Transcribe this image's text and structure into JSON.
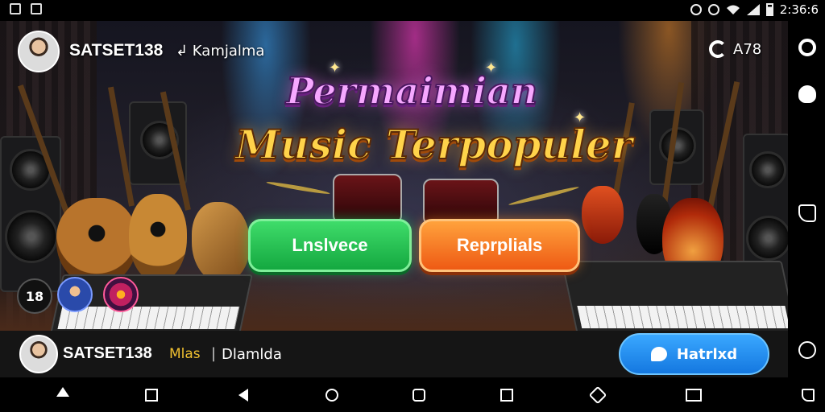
{
  "status_bar": {
    "time": "2:36:6",
    "icons": [
      "notification-square-icon",
      "gallery-icon",
      "alarm-icon",
      "timer-icon",
      "wifi-icon",
      "signal-icon",
      "battery-icon"
    ]
  },
  "header": {
    "username": "SATSET138",
    "subtitle": "↲ Kamjalma",
    "counter": "A78",
    "counter_icon": "gear-icon"
  },
  "hero": {
    "title_line1": "Permaimian",
    "title_line2": "Music Terpopuler"
  },
  "buttons": {
    "primary_label": "Lnslvece",
    "secondary_label": "Reprplials"
  },
  "badges": {
    "age_label": "18"
  },
  "bottom_bar": {
    "username": "SATSET138",
    "tag": "Mlas",
    "separator": "|",
    "subtitle": "Dlamlda",
    "action_label": "Hatrlxd"
  },
  "colors": {
    "primary_green": "#1fbf4f",
    "secondary_orange": "#f37a22",
    "action_blue": "#1e8ff0",
    "title_pink": "#f6a8ff",
    "title_gold": "#ffd34a"
  },
  "right_rail": [
    "search-icon",
    "heart-search-icon",
    "chat-bubble-icon",
    "zoom-icon"
  ],
  "nav_bar": [
    "home-icon",
    "home-outline-icon",
    "back-icon",
    "chat-icon",
    "info-icon",
    "recents-icon",
    "tag-icon",
    "window-icon",
    "message-icon"
  ]
}
